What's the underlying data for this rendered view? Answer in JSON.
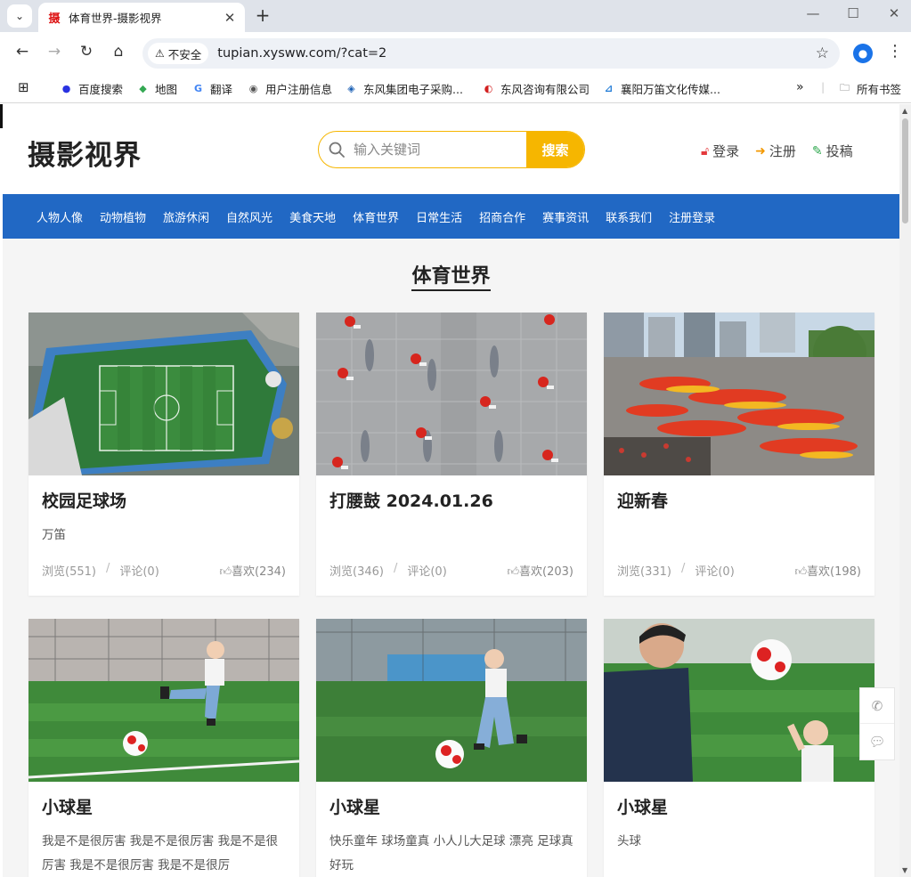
{
  "browser": {
    "tab_title": "体育世界-摄影视界",
    "tab_favicon": "摄",
    "insecure_label": "不安全",
    "url": "tupian.xysww.com/?cat=2",
    "profile_icon": "person-icon"
  },
  "bookmarks": {
    "items": [
      {
        "label": "百度搜索",
        "icon": "baidu-icon",
        "color": "#2932e1",
        "glyph": "●"
      },
      {
        "label": "地图",
        "icon": "maps-icon",
        "color": "#34a853",
        "glyph": "◆"
      },
      {
        "label": "翻译",
        "icon": "translate-icon",
        "color": "#4285f4",
        "glyph": "G"
      },
      {
        "label": "用户注册信息",
        "icon": "globe-icon",
        "color": "#555555",
        "glyph": "◉"
      },
      {
        "label": "东风集团电子采购...",
        "icon": "dongfeng-icon",
        "color": "#1a5fb4",
        "glyph": "◈"
      },
      {
        "label": "东风咨询有限公司",
        "icon": "dfzx-icon",
        "color": "#d21f1f",
        "glyph": "◐"
      },
      {
        "label": "襄阳万笛文化传媒...",
        "icon": "wandi-icon",
        "color": "#1e7ad6",
        "glyph": "⊿"
      }
    ],
    "all_bookmarks": "所有书签"
  },
  "site": {
    "logo": "摄影视界",
    "search_placeholder": "输入关键词",
    "search_button": "搜索",
    "login": "登录",
    "register": "注册",
    "submit": "投稿",
    "accent_color": "#f6b600",
    "nav_color": "#2168c4"
  },
  "nav": [
    "人物人像",
    "动物植物",
    "旅游休闲",
    "自然风光",
    "美食天地",
    "体育世界",
    "日常生活",
    "招商合作",
    "赛事资讯",
    "联系我们",
    "注册登录"
  ],
  "section_title": "体育世界",
  "cards": [
    {
      "title": "校园足球场",
      "desc": "万笛",
      "views": "浏览(551)",
      "comments": "评论(0)",
      "likes": "喜欢(234)",
      "image": "aerial-soccer-field"
    },
    {
      "title": "打腰鼓 2024.01.26",
      "desc": "",
      "views": "浏览(346)",
      "comments": "评论(0)",
      "likes": "喜欢(203)",
      "image": "waist-drum-dancers"
    },
    {
      "title": "迎新春",
      "desc": "",
      "views": "浏览(331)",
      "comments": "评论(0)",
      "likes": "喜欢(198)",
      "image": "dragon-dance-plaza"
    },
    {
      "title": "小球星",
      "desc": "我是不是很厉害 我是不是很厉害 我是不是很厉害 我是不是很厉害 我是不是很厉",
      "image": "toddler-kicking-ball"
    },
    {
      "title": "小球星",
      "desc": "快乐童年 球场童真 小人儿大足球 漂亮 足球真好玩",
      "image": "toddler-running-ball"
    },
    {
      "title": "小球星",
      "desc": "头球",
      "image": "father-son-header"
    }
  ]
}
